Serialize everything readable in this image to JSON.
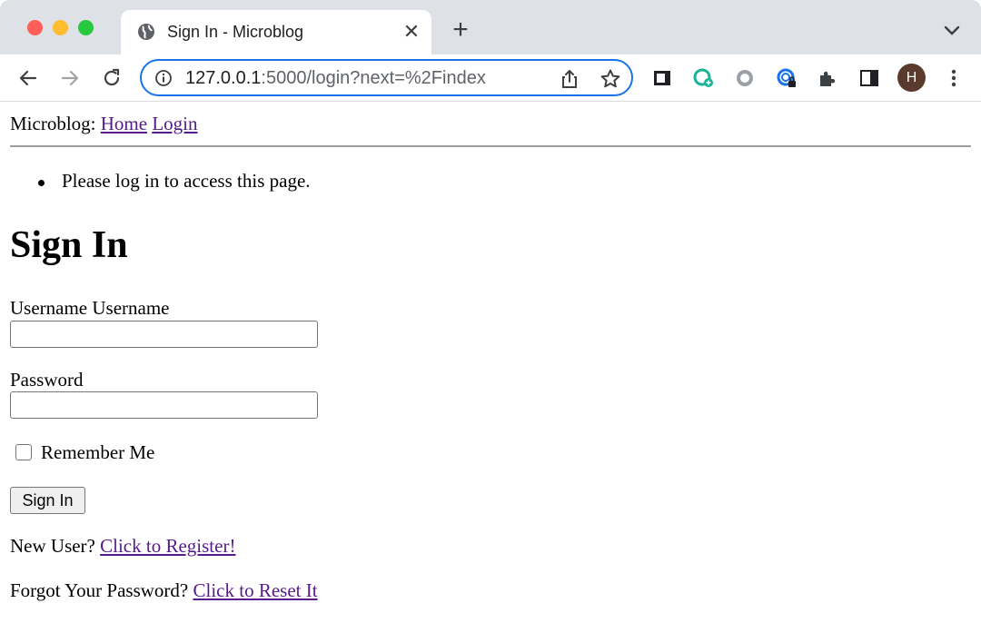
{
  "browser": {
    "tab_title": "Sign In - Microblog",
    "new_tab_symbol": "+",
    "close_symbol": "✕",
    "url_host": "127.0.0.1",
    "url_path": ":5000/login?next=%2Findex",
    "profile_initial": "H",
    "omnibox_border_color": "#1a73e8",
    "tabstrip_color": "#dee1e6"
  },
  "nav": {
    "brand": "Microblog:",
    "links": [
      "Home",
      "Login"
    ]
  },
  "flash": [
    "Please log in to access this page."
  ],
  "form": {
    "heading": "Sign In",
    "username_label": "Username Username",
    "username_value": "",
    "password_label": "Password",
    "password_value": "",
    "remember_label": "Remember Me",
    "remember_checked": false,
    "submit_label": "Sign In"
  },
  "footer": {
    "register_prompt": "New User?",
    "register_link": "Click to Register!",
    "reset_prompt": "Forgot Your Password?",
    "reset_link": "Click to Reset It"
  },
  "colors": {
    "link_visited": "#551a8b"
  }
}
